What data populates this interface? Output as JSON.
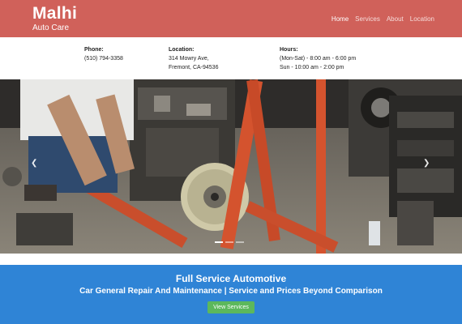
{
  "header": {
    "brand_name": "Malhi",
    "brand_sub": "Auto Care",
    "nav": [
      "Home",
      "Services",
      "About",
      "Location"
    ],
    "active_nav": "Home",
    "color": "#d0615a"
  },
  "info": {
    "phone_label": "Phone:",
    "phone": "(510) 794-3358",
    "location_label": "Location:",
    "address_1": "314 Mowry Ave,",
    "address_2": "Fremont, CA-94536",
    "hours_label": "Hours:",
    "hours_1": "(Mon-Sat) - 8:00 am - 6:00 pm",
    "hours_2": "Sun - 10:00 am - 2:00 pm"
  },
  "hero": {
    "prev_icon": "chevron-left-icon",
    "next_icon": "chevron-right-icon",
    "prev_glyph": "❮",
    "next_glyph": "❯",
    "slide_count": 3,
    "active_slide": 1
  },
  "cta": {
    "title": "Full Service Automotive",
    "subtitle": "Car General Repair And Maintenance | Service and Prices Beyond Comparison",
    "button": "View Services",
    "color": "#2f84d6",
    "button_color": "#5cb85c"
  }
}
